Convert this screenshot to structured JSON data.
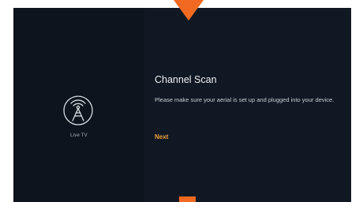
{
  "sidebar": {
    "icon": "antenna-icon",
    "label": "Live TV"
  },
  "main": {
    "title": "Channel Scan",
    "message": "Please make sure your aerial is set up and plugged into your device.",
    "next_label": "Next"
  },
  "colors": {
    "accent": "#f26a21",
    "button_text": "#f2a03d",
    "background_dark": "#0d141d",
    "background_panel": "#101923"
  }
}
